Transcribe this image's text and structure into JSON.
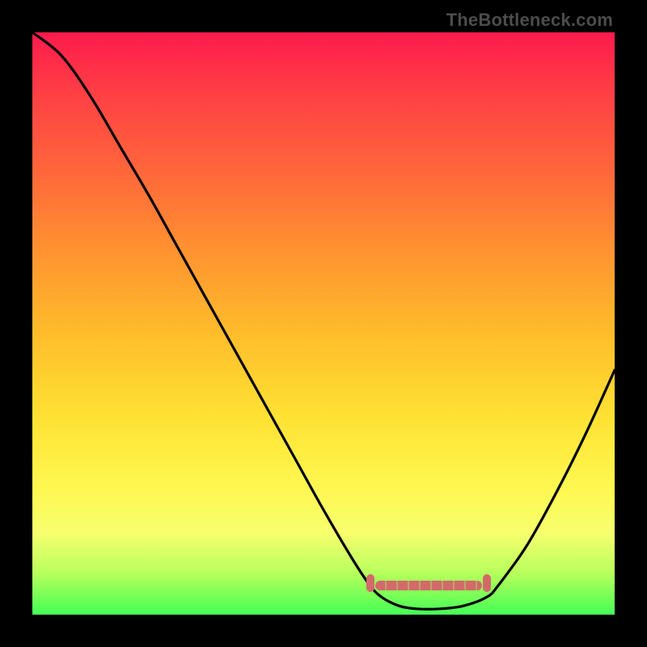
{
  "watermark": "TheBottleneck.com",
  "colors": {
    "background": "#000000",
    "curve": "#000000",
    "marker": "#d36a6a",
    "gradient_top": "#ff1a4d",
    "gradient_bottom": "#44ff55"
  },
  "chart_data": {
    "type": "line",
    "title": "",
    "xlabel": "",
    "ylabel": "",
    "xlim": [
      0,
      100
    ],
    "ylim": [
      0,
      100
    ],
    "note": "Axes and units are not labeled in the image; x and y are normalized 0–100 from left→right and bottom→top of the plot area.",
    "series": [
      {
        "name": "curve",
        "x": [
          0,
          5,
          10,
          15,
          20,
          25,
          30,
          35,
          40,
          45,
          50,
          55,
          58,
          60,
          63,
          66,
          70,
          74,
          78,
          80,
          85,
          90,
          95,
          100
        ],
        "y": [
          100,
          96,
          89,
          80.5,
          72,
          63,
          54,
          45,
          36,
          27,
          18,
          9.5,
          5,
          3,
          1.5,
          1,
          1,
          1.5,
          3,
          5,
          12,
          21,
          31,
          42
        ]
      }
    ],
    "markers": {
      "name": "highlighted-range",
      "x_range": [
        58,
        78
      ],
      "y": 5
    }
  }
}
